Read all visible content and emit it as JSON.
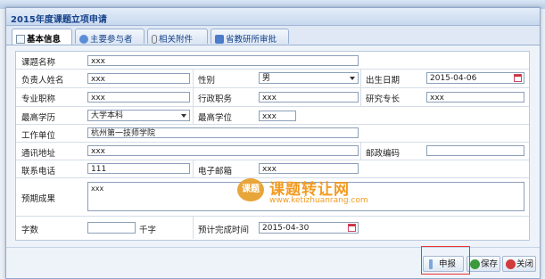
{
  "dialog": {
    "title": "2015年度课题立项申请"
  },
  "tabs": [
    {
      "label": "基本信息",
      "active": true
    },
    {
      "label": "主要参与者",
      "active": false
    },
    {
      "label": "相关附件",
      "active": false
    },
    {
      "label": "省教研所审批",
      "active": false
    }
  ],
  "form": {
    "topic_name_label": "课题名称",
    "topic_name_value": "xxx",
    "leader_name_label": "负责人姓名",
    "leader_name_value": "xxx",
    "gender_label": "性别",
    "gender_value": "男",
    "birth_date_label": "出生日期",
    "birth_date_value": "2015-04-06",
    "title_label": "专业职称",
    "title_value": "xxx",
    "admin_post_label": "行政职务",
    "admin_post_value": "xxx",
    "research_label": "研究专长",
    "research_value": "xxx",
    "education_label": "最高学历",
    "education_value": "大学本科",
    "degree_label": "最高学位",
    "degree_value": "xxx",
    "workplace_label": "工作单位",
    "workplace_value": "杭州第一技师学院",
    "address_label": "通讯地址",
    "address_value": "xxx",
    "postcode_label": "邮政编码",
    "postcode_value": "",
    "phone_label": "联系电话",
    "phone_value": "111",
    "email_label": "电子邮箱",
    "email_value": "xxx",
    "results_label": "预期成果",
    "results_value": "xxx",
    "word_count_label": "字数",
    "word_count_value": "",
    "word_count_unit": "千字",
    "finish_date_label": "预计完成时间",
    "finish_date_value": "2015-04-30"
  },
  "buttons": {
    "submit": "申报",
    "save": "保存",
    "close": "关闭"
  },
  "watermark": {
    "logo": "课题",
    "text": "课题转让网",
    "url": "www.ketizhuanrang.com"
  },
  "colors": {
    "accent": "#15428b",
    "highlight": "#ee3333",
    "watermark": "#f29b22"
  }
}
